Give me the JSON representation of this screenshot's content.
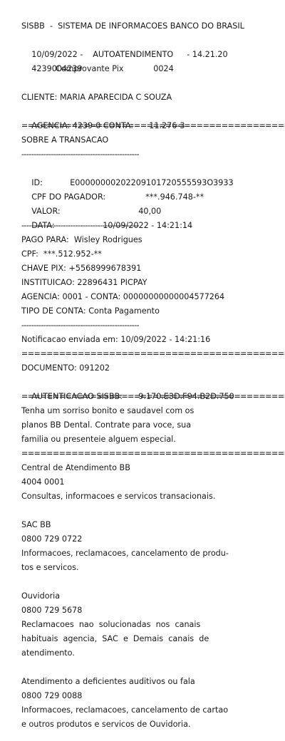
{
  "header": {
    "system": "SISBB  -  SISTEMA DE INFORMACOES BANCO DO BRASIL",
    "date": "10/09/2022 -",
    "mode": "AUTOATENDIMENTO",
    "time": "- 14.21.20",
    "code": "4239004239",
    "terminal": "0024",
    "receipt_title": "Comprovante Pix"
  },
  "client": {
    "name_line": "CLIENTE: MARIA APARECIDA C SOUZA",
    "agency_label": "AGENCIA: 4239-0 CONTA:",
    "account": "11.276-3"
  },
  "separators": {
    "double": "=====================================================",
    "single": "------------------------------------------------"
  },
  "transaction": {
    "title": "SOBRE A TRANSACAO",
    "id_label": "ID:",
    "id_value": "E00000000202209101720555593O3933",
    "payer_cpf_label": "CPF DO PAGADOR:",
    "payer_cpf_value": "***.946.748-**",
    "value_label": "VALOR:",
    "value_value": "40,00",
    "date_label": "DATA:",
    "date_value": "10/09/2022 - 14:21:14"
  },
  "payee": {
    "paid_to": "PAGO PARA:  Wisley Rodrigues",
    "cpf": "CPF:  ***.512.952-**",
    "pix_key": "CHAVE PIX: +5568999678391",
    "institution": "INSTITUICAO: 22896431 PICPAY",
    "agency_account": "AGENCIA: 0001 - CONTA: 00000000000004577264",
    "account_type": "TIPO DE CONTA: Conta Pagamento"
  },
  "notification": "Notificacao enviada em: 10/09/2022 - 14:21:16",
  "document": {
    "doc_line": "DOCUMENTO: 091202",
    "auth_label": "AUTENTICACAO SISBB:",
    "auth_value": "9.170.E3D.F94.B2D.750"
  },
  "promo": {
    "line1": "Tenha um sorriso bonito e saudavel com os",
    "line2": "planos BB Dental. Contrate para voce, sua",
    "line3": "familia ou presenteie alguem especial."
  },
  "contacts": {
    "central_title": "Central de Atendimento BB",
    "central_phone": "4004 0001",
    "central_desc": "Consultas, informacoes e servicos transacionais.",
    "sac_title": "SAC BB",
    "sac_phone": "0800 729 0722",
    "sac_desc1": "Informacoes, reclamacoes, cancelamento de produ-",
    "sac_desc2": "tos e servicos.",
    "ouv_title": "Ouvidoria",
    "ouv_phone": "0800 729 5678",
    "ouv_desc1": "Reclamacoes  nao  solucionadas  nos  canais",
    "ouv_desc2": "habituais  agencia,  SAC  e  Demais  canais  de",
    "ouv_desc3": "atendimento.",
    "def_title": "Atendimento a deficientes auditivos ou fala",
    "def_phone": "0800 729 0088",
    "def_desc1": "Informacoes, reclamacoes, cancelamento de cartao",
    "def_desc2": "e outros produtos e servicos de Ouvidoria."
  }
}
